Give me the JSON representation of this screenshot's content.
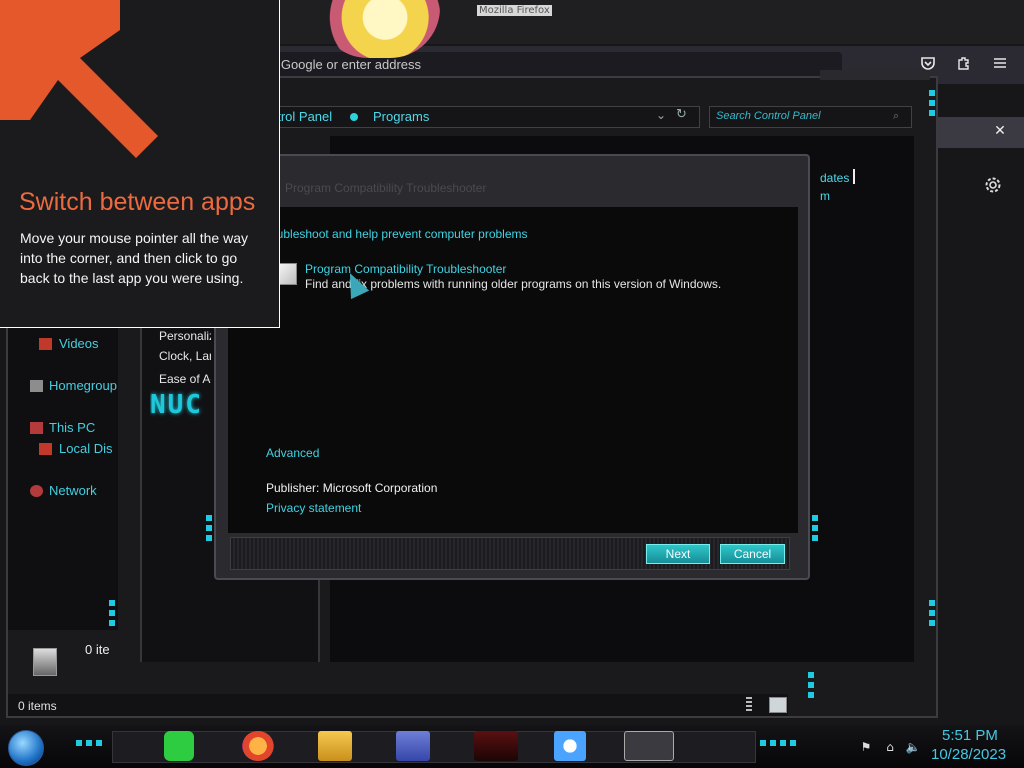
{
  "firefox": {
    "window_title": "Mozilla Firefox",
    "url_placeholder": "n Google or enter address",
    "toolbar_icons": [
      "pocket-icon",
      "extensions-icon",
      "menu-icon"
    ],
    "notification_close": "✕",
    "settings_icon": "gear-icon"
  },
  "explorer": {
    "breadcrumb": [
      "ntrol Panel",
      "Programs"
    ],
    "search_placeholder": "Search Control Panel",
    "right_pane": {
      "updates_label": "dates",
      "m_label": "m"
    },
    "nav_items": [
      {
        "label": "Videos",
        "icon": "videos-icon"
      },
      {
        "label": "Homegroup",
        "icon": "homegroup-icon"
      },
      {
        "label": "This PC",
        "icon": "this-pc-icon"
      },
      {
        "label": "Local Dis",
        "icon": "local-disk-icon"
      },
      {
        "label": "Network",
        "icon": "network-icon"
      }
    ],
    "left_links": [
      "Personaliz",
      "Clock, Lar",
      "Ease of Ac"
    ],
    "logo_text": "NUC",
    "items_count_short": "0 ite",
    "status_text": "0 items"
  },
  "dialog": {
    "title": "Program Compatibility Troubleshooter",
    "heading": "oubleshoot and help prevent computer problems",
    "tool_link": "Program Compatibility Troubleshooter",
    "tool_desc": "Find and fix problems with running older programs on this version of Windows.",
    "advanced_link": "Advanced",
    "publisher": "Publisher:  Microsoft Corporation",
    "privacy_link": "Privacy statement",
    "next_label": "Next",
    "cancel_label": "Cancel"
  },
  "tip": {
    "title": "Switch between apps",
    "body": "Move your mouse pointer all the way into the corner, and then click to go back to the last app you were using.",
    "accent": "#E4582B"
  },
  "taskbar": {
    "apps": [
      "chat-app-icon",
      "firefox-icon",
      "file-explorer-icon",
      "control-panel-icon",
      "media-app-icon",
      "weather-icon",
      "troubleshooter-icon"
    ],
    "tray": [
      "network-error-icon",
      "network-icon",
      "volume-icon"
    ],
    "time": "5:51 PM",
    "date": "10/28/2023"
  },
  "colors": {
    "accent_cyan": "#3FD3E3",
    "tip_orange": "#E4582B",
    "button_teal": "#1FA9B1"
  }
}
